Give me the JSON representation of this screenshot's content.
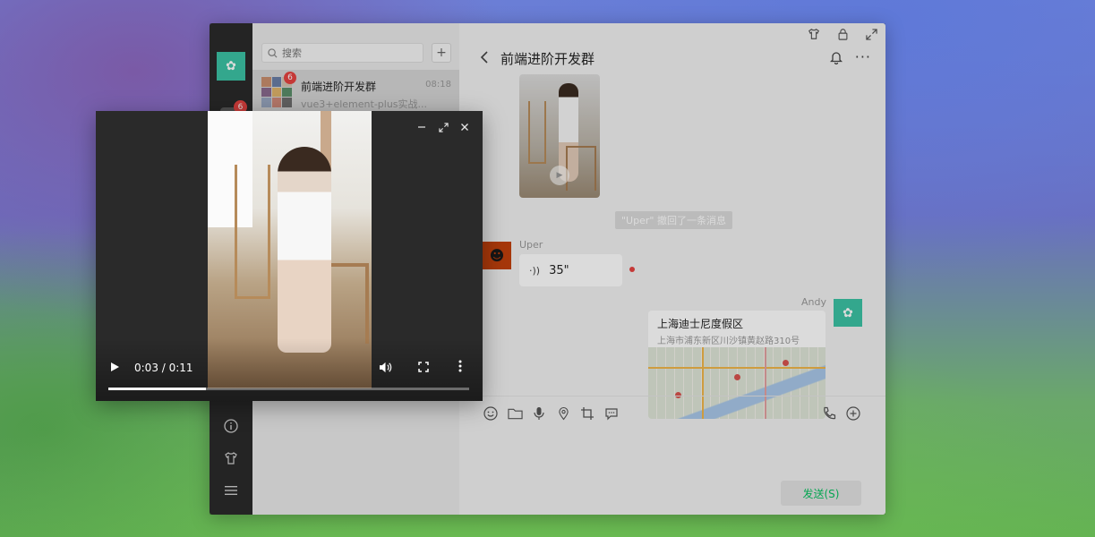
{
  "sidebar": {
    "badge": "6"
  },
  "search": {
    "placeholder": "搜索"
  },
  "session": {
    "name": "前端进阶开发群",
    "time": "08:18",
    "last_message": "vue3+element-plus实战...",
    "badge": "6"
  },
  "chat": {
    "title": "前端进阶开发群",
    "recall_notice": "\"Uper\" 撤回了一条消息",
    "uper_name": "Uper",
    "voice_duration": "35\"",
    "andy_name": "Andy",
    "location_title": "上海迪士尼度假区",
    "location_address": "上海市浦东新区川沙镇黄赵路310号",
    "send_label": "发送(S)"
  },
  "player": {
    "time": "0:03 / 0:11",
    "progress_fraction": 0.27
  },
  "colors": {
    "accent_green": "#07c160",
    "badge_red": "#e64340",
    "avatar_teal": "#3cc3a5"
  }
}
